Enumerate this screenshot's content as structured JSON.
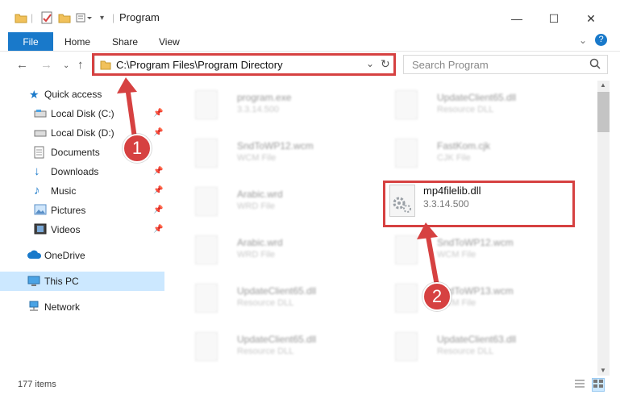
{
  "window": {
    "title": "Program",
    "controls": {
      "minimize": "—",
      "maximize": "☐",
      "close": "✕"
    }
  },
  "ribbon": {
    "tabs": [
      "File",
      "Home",
      "Share",
      "View"
    ]
  },
  "navbar": {
    "address": "C:\\Program Files\\Program Directory",
    "search_placeholder": "Search Program"
  },
  "sidebar": {
    "items": [
      {
        "label": "Quick access",
        "icon": "star-icon"
      },
      {
        "label": "Local Disk (C:)",
        "icon": "drive-icon"
      },
      {
        "label": "Local Disk (D:)",
        "icon": "drive-icon"
      },
      {
        "label": "Documents",
        "icon": "documents-icon"
      },
      {
        "label": "Downloads",
        "icon": "downloads-icon"
      },
      {
        "label": "Music",
        "icon": "music-icon"
      },
      {
        "label": "Pictures",
        "icon": "pictures-icon"
      },
      {
        "label": "Videos",
        "icon": "videos-icon"
      },
      {
        "label": "OneDrive",
        "icon": "cloud-icon"
      },
      {
        "label": "This PC",
        "icon": "pc-icon"
      },
      {
        "label": "Network",
        "icon": "network-icon"
      }
    ]
  },
  "files": [
    {
      "name": "program.exe",
      "sub": "3.3.14.500"
    },
    {
      "name": "UpdateClient65.dll",
      "sub": "Resource DLL"
    },
    {
      "name": "SndToWP12.wcm",
      "sub": "WCM File"
    },
    {
      "name": "FastKom.cjk",
      "sub": "CJK File"
    },
    {
      "name": "Arabic.wrd",
      "sub": "WRD File"
    },
    {
      "name": "mp4filelib.dll",
      "sub": "3.3.14.500"
    },
    {
      "name": "Arabic.wrd",
      "sub": "WRD File"
    },
    {
      "name": "SndToWP12.wcm",
      "sub": "WCM File"
    },
    {
      "name": "UpdateClient65.dll",
      "sub": "Resource DLL"
    },
    {
      "name": "SndToWP13.wcm",
      "sub": "WCM File"
    },
    {
      "name": "UpdateClient65.dll",
      "sub": "Resource DLL"
    },
    {
      "name": "UpdateClient63.dll",
      "sub": "Resource DLL"
    }
  ],
  "status": {
    "items_count": "177 items"
  },
  "annotations": {
    "step1": "1",
    "step2": "2"
  },
  "colors": {
    "accent": "#1979ca",
    "highlight": "#d64141",
    "selected": "#cce8ff"
  }
}
